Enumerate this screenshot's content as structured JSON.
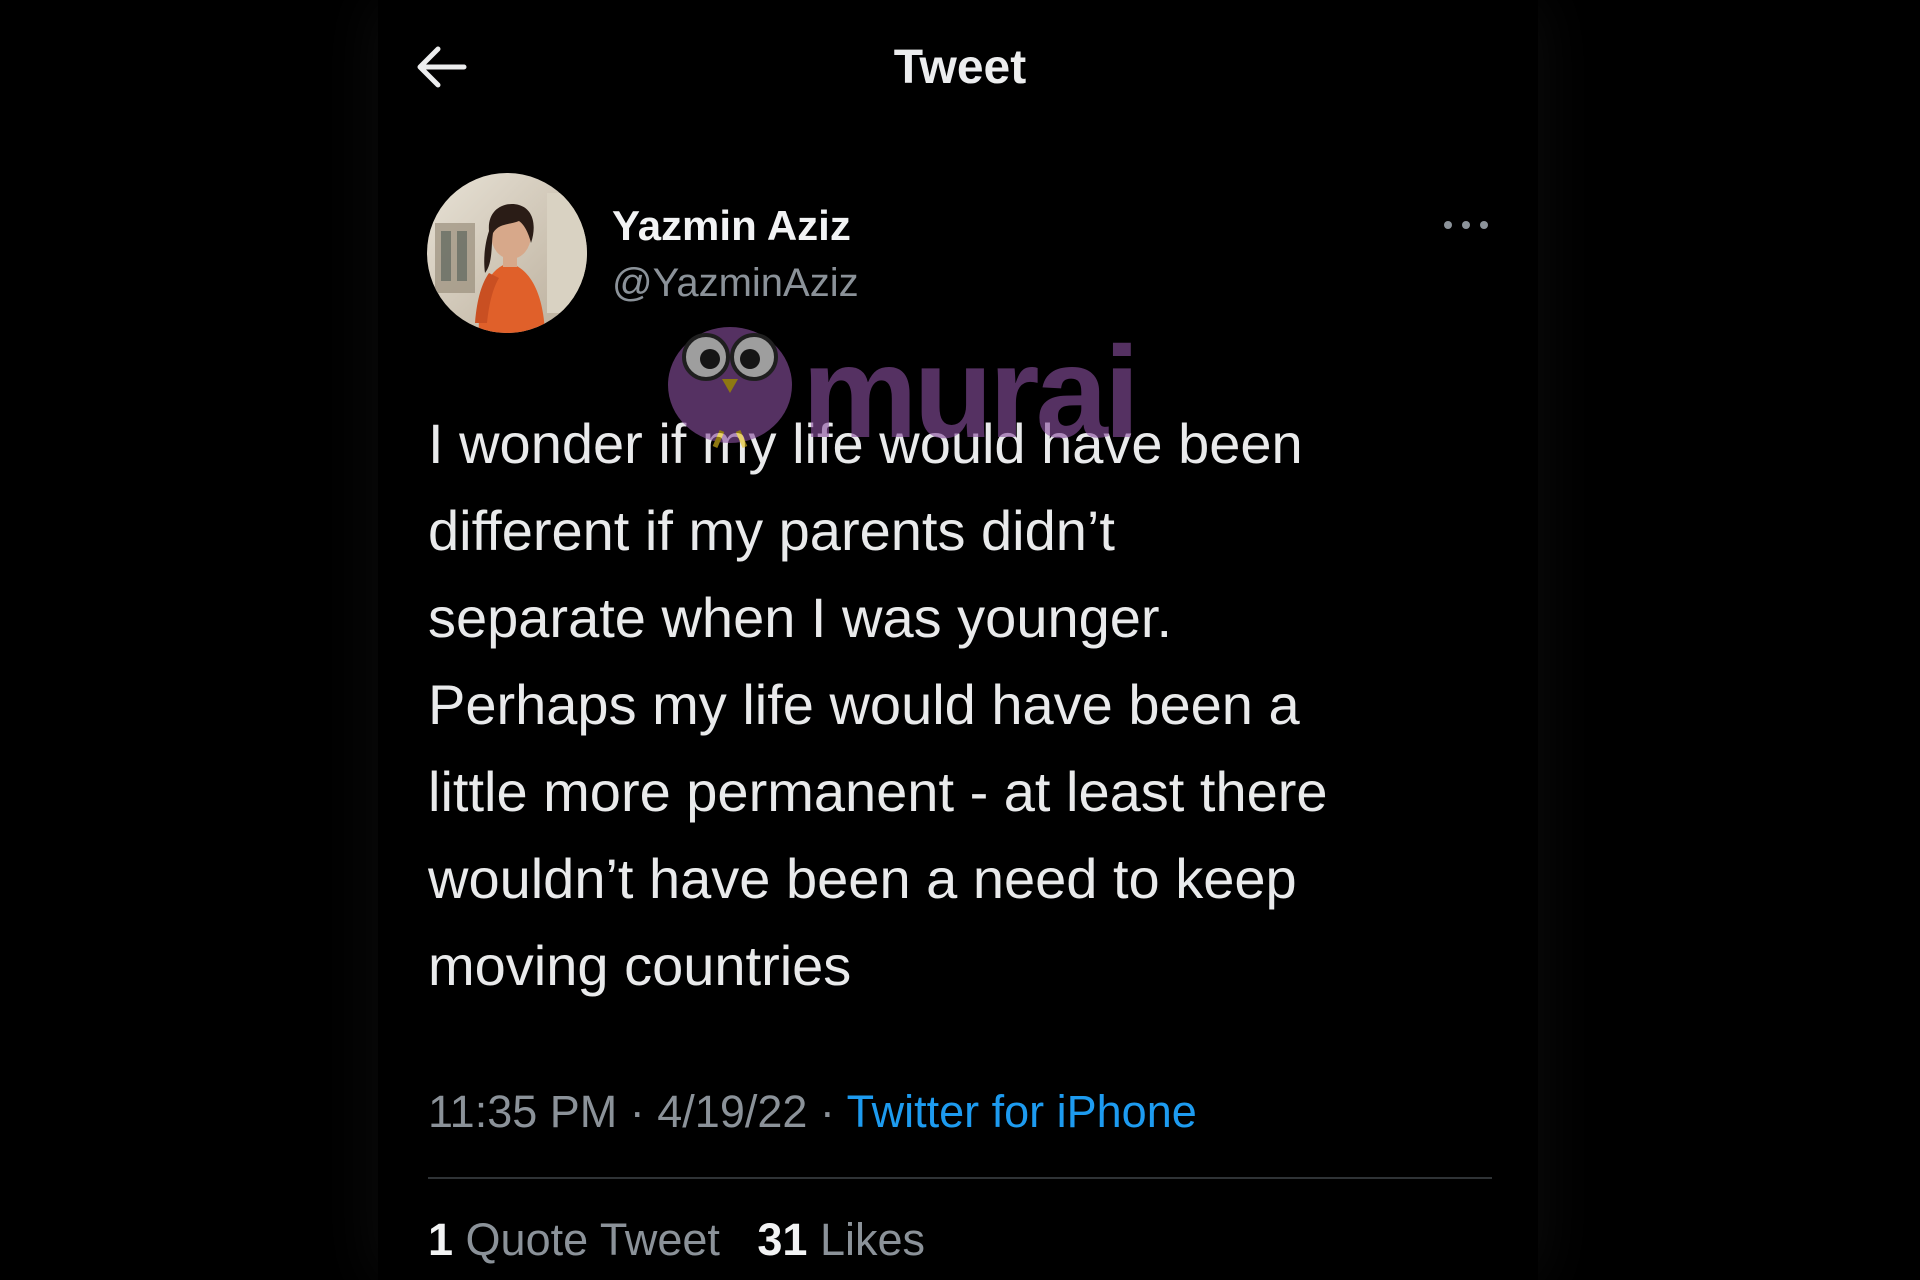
{
  "header": {
    "back_icon": "arrow-left-icon",
    "title": "Tweet"
  },
  "author": {
    "display_name": "Yazmin Aziz",
    "handle": "@YazminAziz",
    "avatar": "avatar-photo",
    "more_icon": "more-horizontal-icon"
  },
  "tweet": {
    "text": "I wonder if my life would have been\ndifferent if my parents didn’t\nseparate when I was younger.\nPerhaps my life would have been a\nlittle more permanent - at least there\nwouldn’t have been a need to keep\nmoving countries"
  },
  "meta": {
    "time": "11:35 PM",
    "separator1": " · ",
    "date": "4/19/22",
    "separator2": " · ",
    "source": "Twitter for iPhone"
  },
  "stats": {
    "quote_count": "1",
    "quote_label": "Quote Tweet",
    "like_count": "31",
    "like_label": "Likes"
  },
  "watermark": {
    "text": "murai"
  },
  "colors": {
    "background": "#000000",
    "text_primary": "#e9eaeb",
    "text_secondary": "#8b9299",
    "link": "#1d9bf0",
    "divider": "#2f3336",
    "watermark": "#8a4f9e"
  }
}
